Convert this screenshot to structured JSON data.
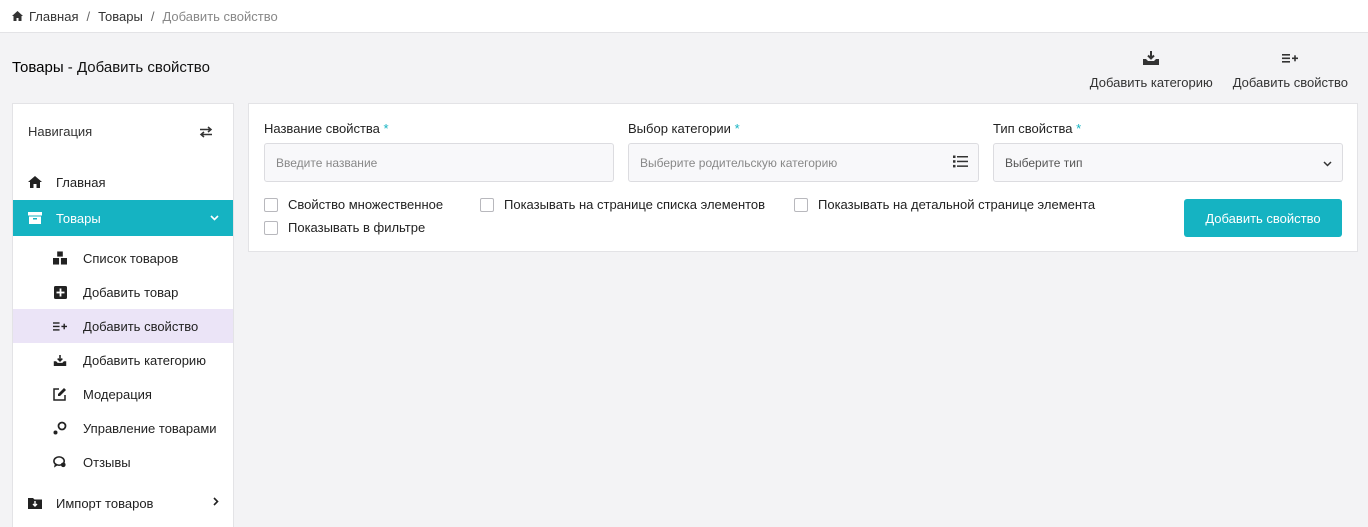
{
  "breadcrumb": {
    "home": "Главная",
    "section": "Товары",
    "current": "Добавить свойство"
  },
  "page_title": {
    "section": "Товары",
    "rest": " - Добавить свойство"
  },
  "top_actions": {
    "add_category": "Добавить категорию",
    "add_property": "Добавить свойство"
  },
  "sidebar": {
    "header": "Навигация",
    "home": "Главная",
    "products": "Товары",
    "sub": {
      "list": "Список товаров",
      "add_product": "Добавить товар",
      "add_property": "Добавить свойство",
      "add_category": "Добавить категорию",
      "moderation": "Модерация",
      "management": "Управление товарами",
      "reviews": "Отзывы"
    },
    "import": "Импорт товаров"
  },
  "form": {
    "name_label": "Название свойства",
    "name_placeholder": "Введите название",
    "category_label": "Выбор категории",
    "category_placeholder": "Выберите родительскую категорию",
    "type_label": "Тип свойства",
    "type_value": "Выберите тип",
    "required_mark": "*",
    "cb_multiple": "Свойство множественное",
    "cb_list_page": "Показывать на странице списка элементов",
    "cb_detail_page": "Показывать на детальной странице элемента",
    "cb_filter": "Показывать в фильтре",
    "submit": "Добавить свойство"
  },
  "colors": {
    "accent": "#15b3c2",
    "active_sub": "#ebe4f7"
  }
}
